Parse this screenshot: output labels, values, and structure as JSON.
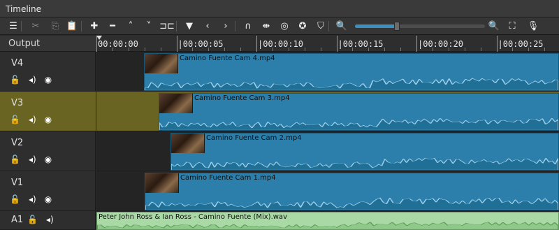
{
  "panel": {
    "title": "Timeline"
  },
  "toolbar": {
    "items": [
      {
        "name": "menu-icon",
        "glyph": "☰"
      },
      {
        "name": "cut-icon",
        "glyph": "✂",
        "dim": true
      },
      {
        "name": "copy-icon",
        "glyph": "⎘",
        "dim": true
      },
      {
        "name": "paste-icon",
        "glyph": "📋"
      },
      {
        "name": "append-icon",
        "glyph": "✚"
      },
      {
        "name": "remove-icon",
        "glyph": "━"
      },
      {
        "name": "lift-icon",
        "glyph": "˄"
      },
      {
        "name": "overwrite-icon",
        "glyph": "˅"
      },
      {
        "name": "split-icon",
        "glyph": "⊐⊏"
      },
      {
        "name": "marker-icon",
        "glyph": "▼"
      },
      {
        "name": "previous-marker-icon",
        "glyph": "‹"
      },
      {
        "name": "next-marker-icon",
        "glyph": "›"
      },
      {
        "name": "snap-icon",
        "glyph": "∩"
      },
      {
        "name": "scrub-icon",
        "glyph": "⇼"
      },
      {
        "name": "ripple-icon",
        "glyph": "◎"
      },
      {
        "name": "ripple-all-icon",
        "glyph": "✪"
      },
      {
        "name": "ripple-markers-icon",
        "glyph": "⛉"
      },
      {
        "name": "zoom-out-icon",
        "glyph": "🔍"
      },
      {
        "name": "zoom-in-icon",
        "glyph": "🔍"
      },
      {
        "name": "zoom-fit-icon",
        "glyph": "⛶"
      },
      {
        "name": "record-audio-icon",
        "glyph": "🎙"
      }
    ],
    "zoom_level": 0.32
  },
  "output_label": "Output",
  "ruler": {
    "labels": [
      "00:00:00",
      "|00:00:05",
      "|00:00:10",
      "|00:00:15",
      "|00:00:20",
      "|00:00:25"
    ]
  },
  "tracks": [
    {
      "name": "V4",
      "selected": false,
      "clip": "Camino Fuente Cam 4.mp4",
      "start": 2.95
    },
    {
      "name": "V3",
      "selected": true,
      "clip": "Camino Fuente Cam 3.mp4",
      "start": 3.9
    },
    {
      "name": "V2",
      "selected": false,
      "clip": "Camino Fuente Cam 2.mp4",
      "start": 4.65
    },
    {
      "name": "V1",
      "selected": false,
      "clip": "Camino Fuente Cam 1.mp4",
      "start": 3.0
    }
  ],
  "audio_track": {
    "name": "A1",
    "clip": "Peter John Ross & Ian Ross - Camino Fuente (Mix).wav"
  },
  "colors": {
    "video_clip": "#2c7faa",
    "audio_clip": "#a9d9a4",
    "selected_track": "#6a6422"
  }
}
